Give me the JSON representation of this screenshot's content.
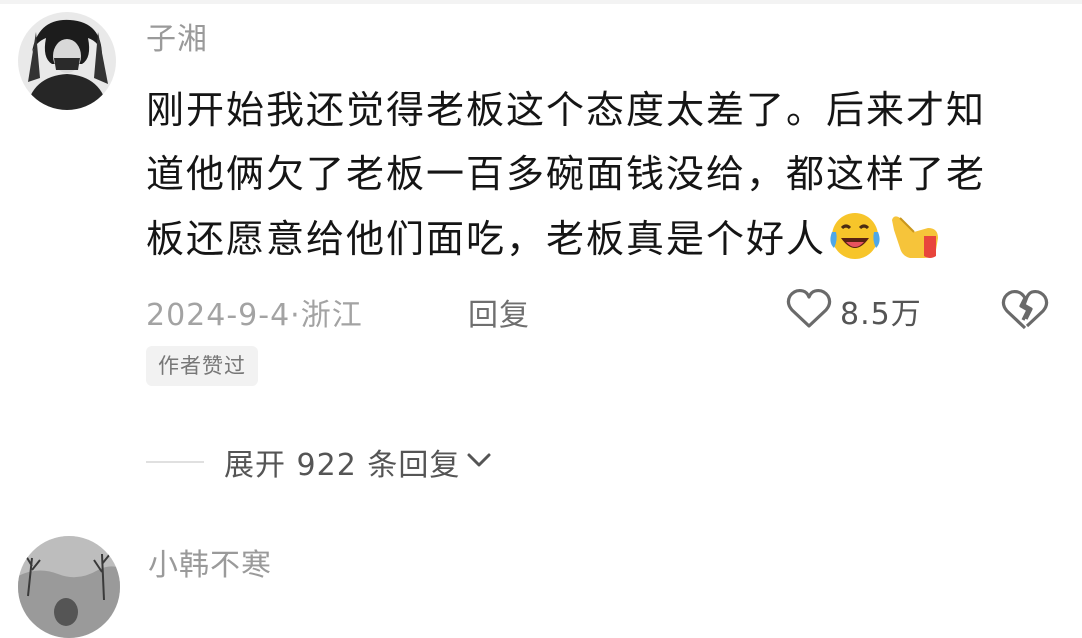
{
  "comment1": {
    "username": "子湘",
    "lines": [
      "刚开始我还觉得老板这个态度太差了。后来才知",
      "道他俩欠了老板一百多碗面钱没给，都这样了老",
      "板还愿意给他们面吃，老板真是个好人"
    ],
    "emojis": [
      "laughing-crying-emoji",
      "pointing-hand-emoji"
    ],
    "meta": "2024-9-4·浙江",
    "reply_label": "回复",
    "like_count": "8.5万",
    "badge": "作者赞过",
    "expand_label": "展开 922 条回复"
  },
  "comment2": {
    "username": "小韩不寒"
  },
  "colors": {
    "username": "#9a9a9a",
    "meta": "#a3a3a3",
    "badge_bg": "#f2f2f2",
    "text": "#151515"
  }
}
